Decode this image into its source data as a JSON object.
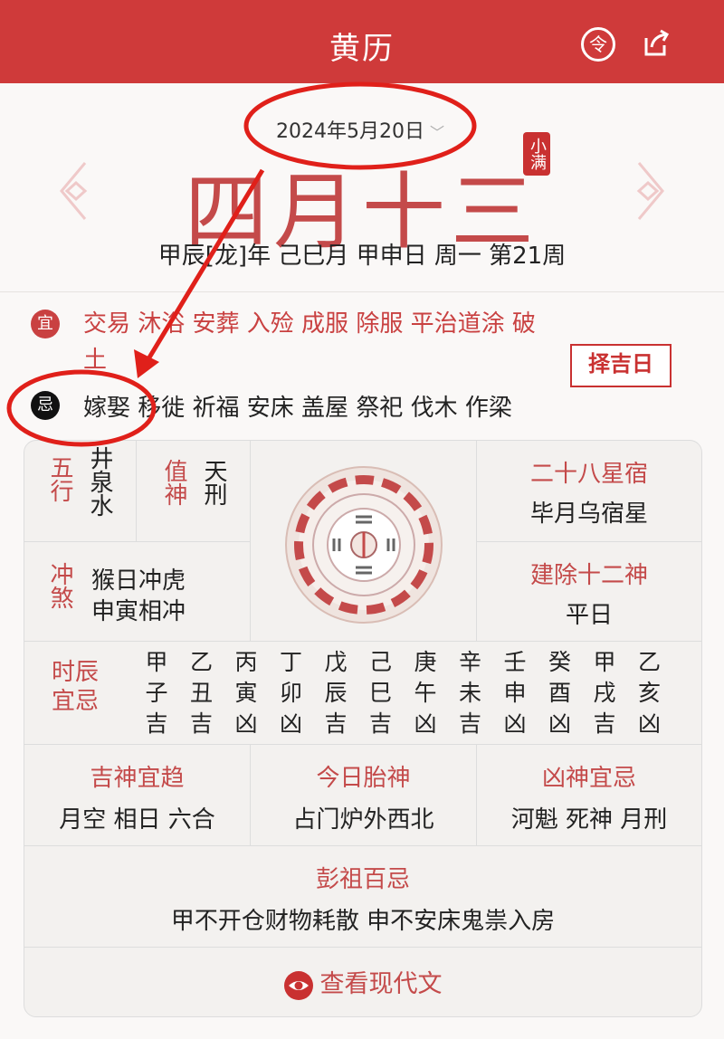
{
  "header": {
    "title": "黄历"
  },
  "date": {
    "selected": "2024年5月20日",
    "chevron": "﹀"
  },
  "lunar_day": "四月十三",
  "solar_term_seal": "小满",
  "ganzhi_line": "甲辰[龙]年 己巳月 甲申日 周一 第21周",
  "yi": {
    "badge": "宜",
    "items": "交易 沐浴 安葬 入殓 成服 除服 平治道涂 破土"
  },
  "ji": {
    "badge": "忌",
    "items": "嫁娶 移徙 祈福 安床 盖屋 祭祀 伐木 作梁"
  },
  "choose_day_button": "择吉日",
  "wuxing": {
    "label": "五行",
    "value": "井泉水"
  },
  "zhishen": {
    "label": "值神",
    "value": "天刑"
  },
  "xingxiu": {
    "label": "二十八星宿",
    "value": "毕月乌宿星"
  },
  "chongsha": {
    "label": "冲煞",
    "line1": "猴日冲虎",
    "line2": "申寅相冲"
  },
  "jianchu": {
    "label": "建除十二神",
    "value": "平日"
  },
  "hours": {
    "label": "时辰宜忌",
    "stems": [
      "甲",
      "乙",
      "丙",
      "丁",
      "戊",
      "己",
      "庚",
      "辛",
      "壬",
      "癸",
      "甲",
      "乙"
    ],
    "branches": [
      "子",
      "丑",
      "寅",
      "卯",
      "辰",
      "巳",
      "午",
      "未",
      "申",
      "酉",
      "戌",
      "亥"
    ],
    "luck": [
      "吉",
      "吉",
      "凶",
      "凶",
      "吉",
      "吉",
      "凶",
      "吉",
      "凶",
      "凶",
      "吉",
      "凶"
    ]
  },
  "jishen": {
    "label": "吉神宜趋",
    "value": "月空 相日 六合"
  },
  "taishen": {
    "label": "今日胎神",
    "value": "占门炉外西北"
  },
  "xiongshen": {
    "label": "凶神宜忌",
    "value": "河魁 死神 月刑"
  },
  "pengzu": {
    "label": "彭祖百忌",
    "value": "甲不开仓财物耗散 申不安床鬼祟入房"
  },
  "modern_text_button": "查看现代文",
  "colors": {
    "brand_red": "#cf3a3a",
    "text_red": "#c44a4a",
    "annotation": "#e0201a"
  }
}
